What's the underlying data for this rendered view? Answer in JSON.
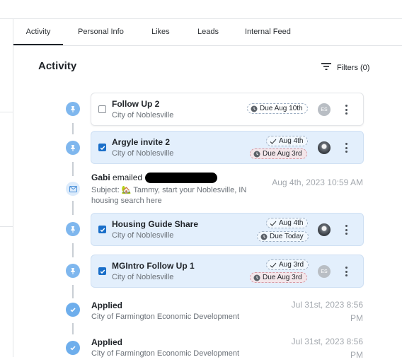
{
  "tabs": [
    {
      "label": "Activity",
      "active": true
    },
    {
      "label": "Personal Info"
    },
    {
      "label": "Likes"
    },
    {
      "label": "Leads"
    },
    {
      "label": "Internal Feed"
    }
  ],
  "section": {
    "title": "Activity",
    "filters_label": "Filters (0)"
  },
  "tasks": [
    {
      "title": "Follow Up 2",
      "subtitle": "City of Noblesville",
      "checked": false,
      "done_date": "",
      "due": "Due Aug 10th",
      "due_style": "normal",
      "avatar": "ES"
    },
    {
      "title": "Argyle invite 2",
      "subtitle": "City of Noblesville",
      "checked": true,
      "done_date": "Aug 4th",
      "due": "Due Aug 3rd",
      "due_style": "overdue",
      "avatar": ""
    },
    {
      "title": "Housing Guide Share",
      "subtitle": "City of Noblesville",
      "checked": true,
      "done_date": "Aug 4th",
      "due": "Due Today",
      "due_style": "normal",
      "avatar": ""
    },
    {
      "title": "MGIntro Follow Up 1",
      "subtitle": "City of Noblesville",
      "checked": true,
      "done_date": "Aug 3rd",
      "due": "Due Aug 3rd",
      "due_style": "overdue",
      "avatar": "ES"
    }
  ],
  "email": {
    "sender": "Gabi",
    "verb": "emailed",
    "subject": "Subject: 🏡 Tammy, start your Noblesville, IN housing search here",
    "timestamp": "Aug 4th, 2023 10:59 AM"
  },
  "applied": [
    {
      "title": "Applied",
      "subtitle": "City of Farmington Economic Development",
      "timestamp": "Jul 31st, 2023 8:56 PM"
    },
    {
      "title": "Applied",
      "subtitle": "City of Farmington Economic Development",
      "timestamp": "Jul 31st, 2023 8:56 PM"
    }
  ],
  "colors": {
    "accent": "#1a6fc9",
    "card_blue": "#e3effc",
    "overdue": "#f3e6ea"
  },
  "icons": [
    "pin-icon",
    "mail-icon",
    "check-circle-icon",
    "filter-icon",
    "clock-icon",
    "checkmark-icon",
    "kebab-menu-icon"
  ]
}
